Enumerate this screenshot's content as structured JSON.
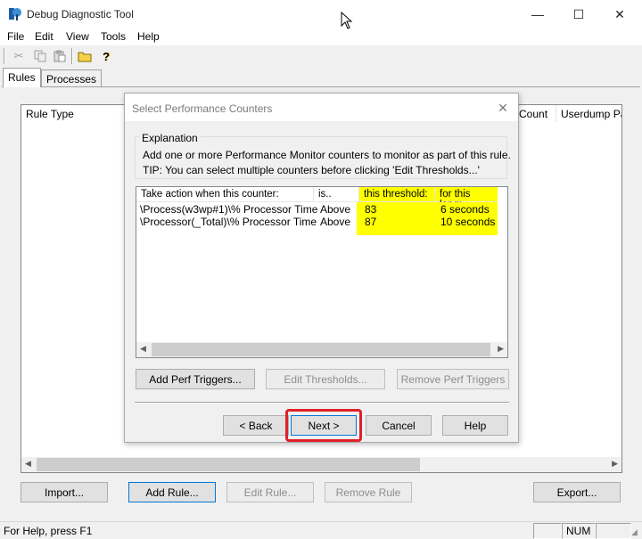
{
  "app": {
    "title": "Debug Diagnostic Tool",
    "window_controls": {
      "minimize": "—",
      "maximize": "☐",
      "close": "✕"
    }
  },
  "menu": [
    "File",
    "Edit",
    "View",
    "Tools",
    "Help"
  ],
  "toolbar_icons": [
    "cut-icon",
    "copy-icon",
    "paste-icon",
    "open-folder-icon",
    "help-icon"
  ],
  "tabs": [
    {
      "label": "Rules",
      "active": true
    },
    {
      "label": "Processes",
      "active": false
    }
  ],
  "main_list": {
    "columns": [
      "Rule Type",
      "Count",
      "Userdump Pat"
    ]
  },
  "main_buttons": {
    "import": "Import...",
    "add_rule": "Add Rule...",
    "edit_rule": "Edit Rule...",
    "remove_rule": "Remove Rule",
    "export": "Export..."
  },
  "statusbar": {
    "help_text": "For Help, press F1",
    "num": "NUM"
  },
  "dialog": {
    "title": "Select Performance Counters",
    "close": "✕",
    "explanation": {
      "label": "Explanation",
      "line1": "Add one or more Performance Monitor counters to monitor as part of this rule.",
      "line2": "TIP:  You can select multiple counters before clicking 'Edit Thresholds...'"
    },
    "list": {
      "columns": [
        "Take action when this counter:",
        "is..",
        "this threshold:",
        "for this long:"
      ],
      "rows": [
        {
          "counter": "\\Process(w3wp#1)\\% Processor Time",
          "is": "Above",
          "threshold": "83",
          "duration": "6 seconds"
        },
        {
          "counter": "\\Processor(_Total)\\% Processor Time",
          "is": "Above",
          "threshold": "87",
          "duration": "10 seconds"
        }
      ]
    },
    "buttons": {
      "add_perf_triggers": "Add Perf Triggers...",
      "edit_thresholds": "Edit Thresholds...",
      "remove_perf_triggers": "Remove Perf Triggers",
      "back": "< Back",
      "next": "Next >",
      "cancel": "Cancel",
      "help": "Help"
    }
  },
  "colors": {
    "highlight": "#ffff00",
    "callout": "#e0202a",
    "accent": "#0078d7"
  }
}
